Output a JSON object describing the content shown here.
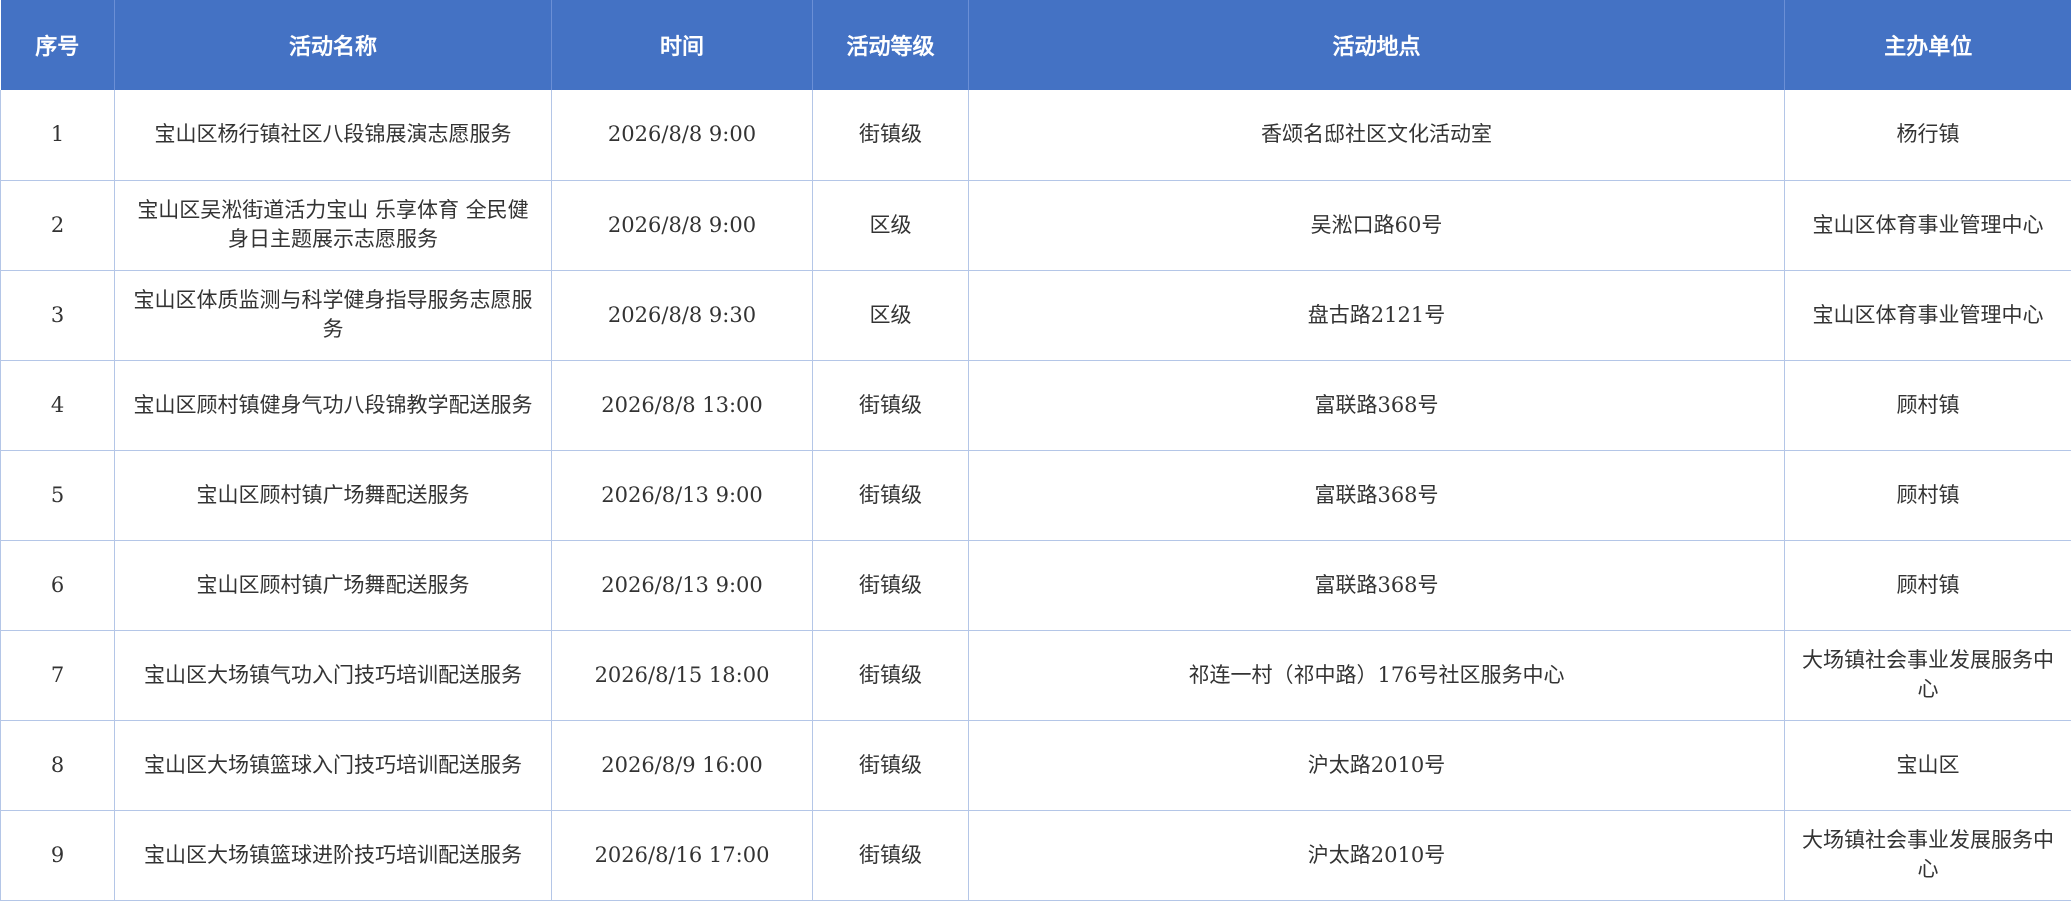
{
  "table": {
    "headers": [
      "序号",
      "活动名称",
      "时间",
      "活动等级",
      "活动地点",
      "主办单位"
    ],
    "rows": [
      {
        "no": "1",
        "name": "宝山区杨行镇社区八段锦展演志愿服务",
        "time": "2026/8/8  9:00",
        "level": "街镇级",
        "location": "香颂名邸社区文化活动室",
        "organizer": "杨行镇"
      },
      {
        "no": "2",
        "name": "宝山区吴淞街道活力宝山 乐享体育 全民健身日主题展示志愿服务",
        "time": "2026/8/8  9:00",
        "level": "区级",
        "location": "吴淞口路60号",
        "organizer": "宝山区体育事业管理中心"
      },
      {
        "no": "3",
        "name": "宝山区体质监测与科学健身指导服务志愿服务",
        "time": "2026/8/8  9:30",
        "level": "区级",
        "location": "盘古路2121号",
        "organizer": "宝山区体育事业管理中心"
      },
      {
        "no": "4",
        "name": "宝山区顾村镇健身气功八段锦教学配送服务",
        "time": "2026/8/8  13:00",
        "level": "街镇级",
        "location": "富联路368号",
        "organizer": "顾村镇"
      },
      {
        "no": "5",
        "name": "宝山区顾村镇广场舞配送服务",
        "time": "2026/8/13  9:00",
        "level": "街镇级",
        "location": "富联路368号",
        "organizer": "顾村镇"
      },
      {
        "no": "6",
        "name": "宝山区顾村镇广场舞配送服务",
        "time": "2026/8/13  9:00",
        "level": "街镇级",
        "location": "富联路368号",
        "organizer": "顾村镇"
      },
      {
        "no": "7",
        "name": "宝山区大场镇气功入门技巧培训配送服务",
        "time": "2026/8/15  18:00",
        "level": "街镇级",
        "location": "祁连一村（祁中路）176号社区服务中心",
        "organizer": "大场镇社会事业发展服务中心"
      },
      {
        "no": "8",
        "name": "宝山区大场镇篮球入门技巧培训配送服务",
        "time": "2026/8/9  16:00",
        "level": "街镇级",
        "location": "沪太路2010号",
        "organizer": "宝山区"
      },
      {
        "no": "9",
        "name": "宝山区大场镇篮球进阶技巧培训配送服务",
        "time": "2026/8/16  17:00",
        "level": "街镇级",
        "location": "沪太路2010号",
        "organizer": "大场镇社会事业发展服务中心"
      }
    ]
  }
}
